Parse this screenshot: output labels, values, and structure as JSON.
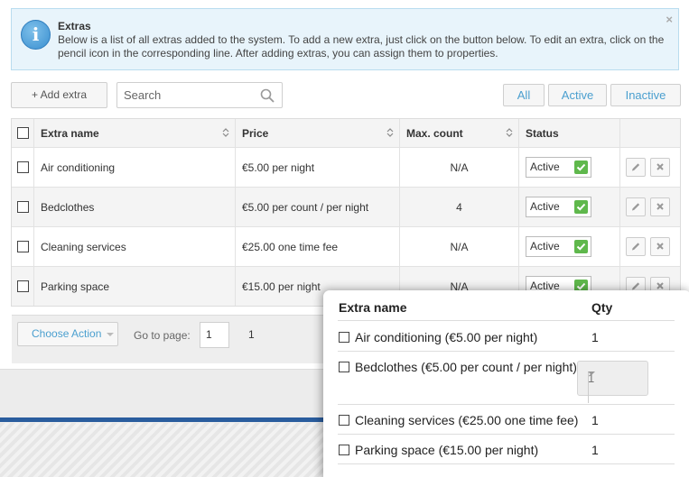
{
  "info": {
    "title": "Extras",
    "text": "Below is a list of all extras added to the system. To add a new extra, just click on the button below. To edit an extra, click on the pencil icon in the corresponding line. After adding extras, you can assign them to properties.",
    "close": "×",
    "icon": "info-icon"
  },
  "toolbar": {
    "add_label": "+ Add extra",
    "search_placeholder": "Search",
    "filters": [
      "All",
      "Active",
      "Inactive"
    ]
  },
  "table": {
    "columns": [
      "Extra name",
      "Price",
      "Max. count",
      "Status"
    ],
    "rows": [
      {
        "name": "Air conditioning",
        "price": "€5.00 per night",
        "max": "N/A",
        "status": "Active"
      },
      {
        "name": "Bedclothes",
        "price": "€5.00 per count / per night",
        "max": "4",
        "status": "Active"
      },
      {
        "name": "Cleaning services",
        "price": "€25.00 one time fee",
        "max": "N/A",
        "status": "Active"
      },
      {
        "name": "Parking space",
        "price": "€15.00 per night",
        "max": "N/A",
        "status": "Active"
      }
    ]
  },
  "footer": {
    "choose_action": "Choose Action",
    "goto_label": "Go to page:",
    "goto_value": "1",
    "page": "1"
  },
  "popup": {
    "col_name": "Extra name",
    "col_qty": "Qty",
    "items": [
      {
        "label": "Air conditioning (€5.00 per night)",
        "qty": "1"
      },
      {
        "label": "Bedclothes (€5.00 per count / per night)",
        "qty": "1"
      },
      {
        "label": "Cleaning services (€25.00 one time fee)",
        "qty": "1"
      },
      {
        "label": "Parking space (€15.00 per night)",
        "qty": "1"
      }
    ]
  },
  "colors": {
    "accent": "#4a9fcf",
    "status_ok": "#5fb84c",
    "bluebar": "#2a5d9e"
  }
}
